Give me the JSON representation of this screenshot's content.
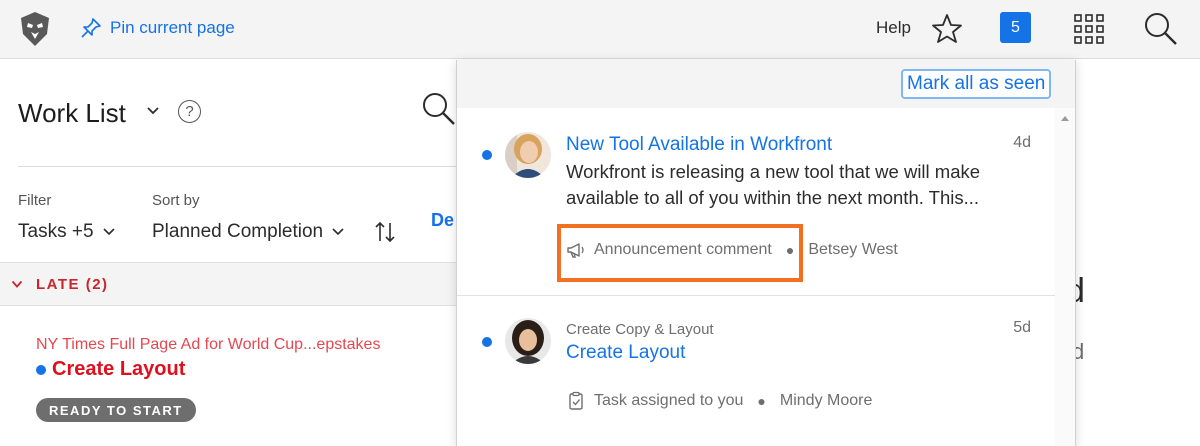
{
  "topbar": {
    "pin_label": "Pin current page",
    "help_label": "Help",
    "notification_count": "5"
  },
  "worklist": {
    "title": "Work List",
    "help_glyph": "?",
    "de_link": "De",
    "filter": {
      "label": "Filter",
      "value": "Tasks +5"
    },
    "sort": {
      "label": "Sort by",
      "value": "Planned Completion"
    },
    "group": {
      "label": "LATE (2)"
    },
    "item": {
      "project": "NY Times Full Page Ad for World Cup...epstakes",
      "task": "Create Layout",
      "status": "READY TO START"
    },
    "peek_large": "d",
    "peek_small": "d"
  },
  "notifications": {
    "mark_all_label": "Mark all as seen",
    "items": [
      {
        "title": "New Tool Available in Workfront",
        "body": "Workfront is releasing a new tool that we will make available to all of you within the next month. This...",
        "age": "4d",
        "type": "Announcement comment",
        "type_icon": "megaphone-icon",
        "author": "Betsey West",
        "unread": true
      },
      {
        "subtitle": "Create Copy & Layout",
        "title": "Create Layout",
        "age": "5d",
        "type": "Task assigned to you",
        "type_icon": "clipboard-check-icon",
        "author": "Mindy Moore",
        "unread": true
      }
    ]
  },
  "colors": {
    "accent": "#1473e6",
    "late": "#c9252d",
    "highlight": "#f37021"
  }
}
